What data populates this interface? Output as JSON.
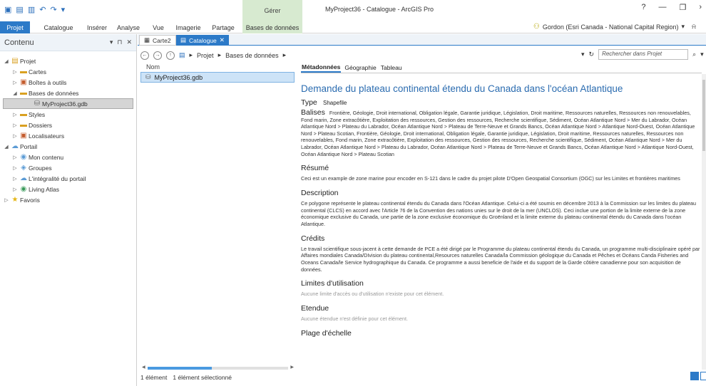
{
  "window": {
    "title": "MyProject36 - Catalogue - ArcGIS Pro",
    "context_group": "Gérer",
    "controls": {
      "help": "?",
      "minimize": "—",
      "restore": "❐",
      "more": "›"
    }
  },
  "ribbon": {
    "tabs": [
      {
        "label": "Projet",
        "active": true
      },
      {
        "label": "Catalogue"
      },
      {
        "label": "Insérer"
      },
      {
        "label": "Analyse"
      },
      {
        "label": "Vue"
      },
      {
        "label": "Imagerie"
      },
      {
        "label": "Partage"
      },
      {
        "label": "Bases de données",
        "context": true
      }
    ],
    "user": "Gordon (Esri Canada - National Capital Region)",
    "user_menu": "▾",
    "notifications_icon": "bell-icon"
  },
  "contents": {
    "title": "Contenu",
    "controls": {
      "menu": "▾",
      "pin": "⊓",
      "close": "✕"
    },
    "tree": [
      {
        "label": "Projet",
        "arrow": "◢",
        "icon": "project",
        "level": 0
      },
      {
        "label": "Cartes",
        "arrow": "▷",
        "icon": "folder",
        "level": 1
      },
      {
        "label": "Boîtes à outils",
        "arrow": "▷",
        "icon": "toolbox",
        "level": 1
      },
      {
        "label": "Bases de données",
        "arrow": "◢",
        "icon": "database",
        "level": 1
      },
      {
        "label": "MyProject36.gdb",
        "arrow": "",
        "icon": "gdb",
        "level": 2,
        "selected": true
      },
      {
        "label": "Styles",
        "arrow": "▷",
        "icon": "folder",
        "level": 1
      },
      {
        "label": "Dossiers",
        "arrow": "▷",
        "icon": "folder",
        "level": 1
      },
      {
        "label": "Localisateurs",
        "arrow": "▷",
        "icon": "locator",
        "level": 1
      },
      {
        "label": "Portail",
        "arrow": "◢",
        "icon": "portal",
        "level": 0
      },
      {
        "label": "Mon contenu",
        "arrow": "▷",
        "icon": "globe",
        "level": 1
      },
      {
        "label": "Groupes",
        "arrow": "▷",
        "icon": "groups",
        "level": 1
      },
      {
        "label": "L'intégralité du portail",
        "arrow": "▷",
        "icon": "cloud",
        "level": 1
      },
      {
        "label": "Living Atlas",
        "arrow": "▷",
        "icon": "atlas",
        "level": 1
      },
      {
        "label": "Favoris",
        "arrow": "▷",
        "icon": "star",
        "level": 0
      }
    ]
  },
  "doc_tabs": [
    {
      "label": "Carte2",
      "active": false
    },
    {
      "label": "Catalogue",
      "active": true,
      "close": "✕"
    }
  ],
  "breadcrumb": {
    "back": "←",
    "forward": "→",
    "up": "↑",
    "sep": "▸",
    "path": [
      "Projet",
      "Bases de données"
    ],
    "refresh": "↻",
    "dropdown": "▾",
    "search_placeholder": "Rechercher dans Projet",
    "search_icon": "⌕"
  },
  "items": {
    "column": "Nom",
    "rows": [
      {
        "label": "MyProject36.gdb",
        "selected": true
      }
    ],
    "status": [
      "1 élément",
      "1 élément sélectionné"
    ]
  },
  "metadata": {
    "tabs": [
      "Métadonnées",
      "Géographie",
      "Tableau"
    ],
    "title": "Demande du plateau continental étendu du Canada dans l'océan Atlantique",
    "type_label": "Type",
    "type_value": "Shapefile",
    "tags_label": "Balises",
    "tags": "Frontière, Géologie, Droit international, Obligation légale, Garantie juridique, Législation, Droit maritime, Ressources naturelles, Ressources non renouvelables, Fond marin, Zone extracôtière, Exploitation des ressources, Gestion des ressources, Recherche scientifique, Sédiment, Océan Atlantique Nord > Mer du Labrador, Océan Atlantique Nord > Plateau du Labrador, Océan Atlantique Nord > Plateau de Terre-Neuve et Grands Bancs, Océan Atlantique Nord > Atlantique Nord-Ouest, Océan Atlantique Nord > Plateau Scotian, Frontière, Géologie, Droit international, Obligation légale, Garantie juridique, Législation, Droit maritime, Ressources naturelles, Ressources non renouvelables, Fond marin, Zone extracôtière, Exploitation des ressources, Gestion des ressources, Recherche scientifique, Sédiment, Océan Atlantique Nord > Mer du Labrador, Océan Atlantique Nord > Plateau du Labrador, Océan Atlantique Nord > Plateau de Terre-Neuve et Grands Bancs, Océan Atlantique Nord > Atlantique Nord-Ouest, Océan Atlantique Nord > Plateau Scotian",
    "summary_h": "Résumé",
    "summary": "Ceci est un example de zone marine pour encoder en S-121 dans le cadre du projet pilote D'Open Geospatial Consortium (OGC) sur les Limites et frontières maritimes",
    "desc_h": "Description",
    "desc": "Ce polygone représente le plateau continental étendu du Canada dans l'Océan Atlantique. Celui-ci a été soumis en décembre 2013 à la Commission sur les limites du plateau continental (CLCS) en accord avec l'Article 76 de la Convention des nations unies sur le droit de la mer (UNCLOS). Ceci inclue une portion de la limite externe de la zone économique exclusive du Canada, une partie de la zone exclusive économique du Groënland et la limite externe du plateau continental étendu du Canada dans l'océan Atlantique.",
    "credits_h": "Crédits",
    "credits": "Le travail scientifique sous-jacent à cette demande de PCE a été dirigé par le Programme du plateau continental étendu du Canada, un programme multi-disciplinaire opéré par Affaires mondiales Canada/DIvision du plateau continental,Resources naturelles Canada/la Commission géologique du Canada et Pêches et Océans Canda Fisheries and Oceans Canada/le Service hydrographique du Canada. Ce programme a aussi beneficie de l'aide et du support de la Garde côtière canadienne pour son acquisition de données.",
    "limits_h": "Limites d'utilisation",
    "limits": "Aucune limite d'accès ou d'utilisation n'existe pour cet élément.",
    "extent_h": "Etendue",
    "extent": "Aucune étendue n'est définie pour cet élément.",
    "scale_h": "Plage d'échelle"
  },
  "colors": {
    "accent": "#2c7ac8",
    "context_tab": "#d7ead0",
    "title_link": "#2b6cb0"
  }
}
